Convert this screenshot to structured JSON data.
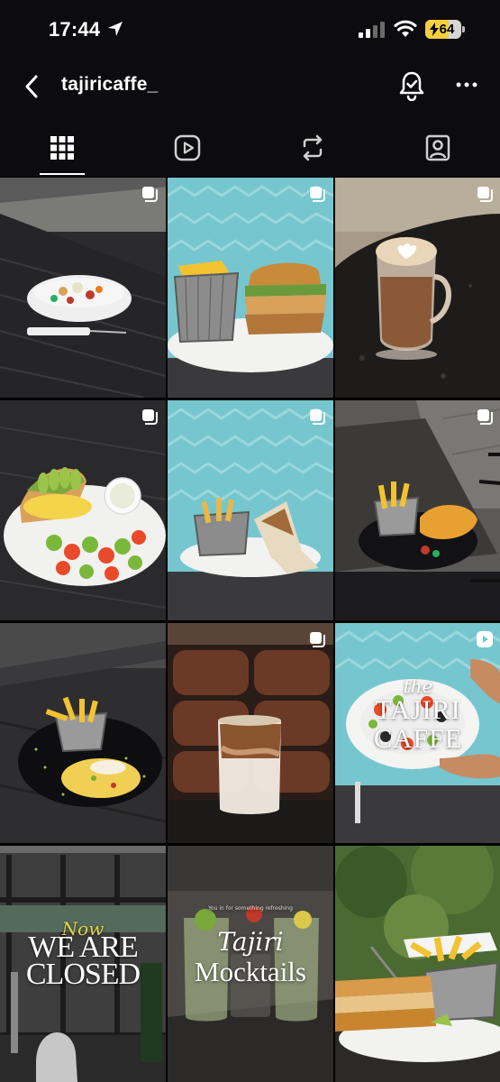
{
  "status_bar": {
    "time": "17:44",
    "battery": "64",
    "battery_level": 0.64
  },
  "header": {
    "username": "tajiricaffe_"
  },
  "tabs": [
    {
      "name": "tab-grid",
      "icon": "grid-icon",
      "active": true
    },
    {
      "name": "tab-reels",
      "icon": "reels-icon",
      "active": false
    },
    {
      "name": "tab-reposts",
      "icon": "repost-icon",
      "active": false
    },
    {
      "name": "tab-tagged",
      "icon": "tagged-icon",
      "active": false
    }
  ],
  "posts": [
    {
      "subject": "salad",
      "badge": "carousel-icon"
    },
    {
      "subject": "sandwich-fries",
      "badge": "carousel-icon"
    },
    {
      "subject": "latte-art",
      "badge": "carousel-icon"
    },
    {
      "subject": "avocado-toast",
      "badge": "carousel-icon"
    },
    {
      "subject": "wraps-fries",
      "badge": "carousel-icon"
    },
    {
      "subject": "fish-fries",
      "badge": "carousel-icon"
    },
    {
      "subject": "omelette-fries",
      "badge": ""
    },
    {
      "subject": "iced-latte",
      "badge": "carousel-icon"
    },
    {
      "subject": "salad-plate-logo",
      "badge": "reel-icon"
    },
    {
      "subject": "closed-sign",
      "badge": ""
    },
    {
      "subject": "mocktails",
      "badge": ""
    },
    {
      "subject": "toast-fries",
      "badge": ""
    }
  ],
  "overlays": {
    "logo_the": "the",
    "logo_main": "TAJIRI",
    "logo_sub": "CAFFE",
    "closed_script": "Now",
    "closed_line1": "WE ARE",
    "closed_line2": "CLOSED",
    "mock_small": "You in for something refreshing",
    "mock_script": "Tajiri",
    "mock_main": "Mocktails"
  },
  "colors": {
    "background": "#0c0c0f",
    "battery": "#f4d03f",
    "text": "#ffffff"
  }
}
